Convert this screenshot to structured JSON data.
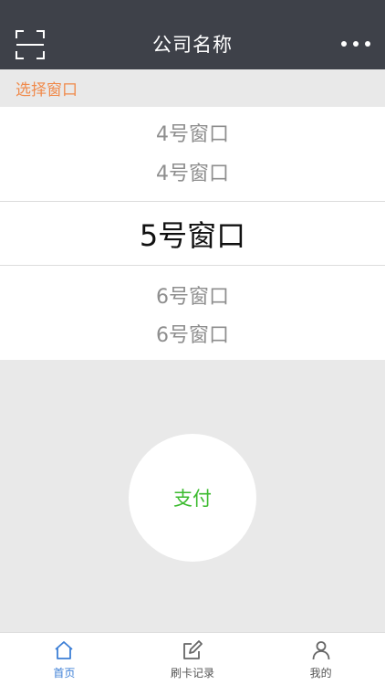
{
  "header": {
    "title": "公司名称",
    "left_icon": "scan-icon",
    "right_icon": "more-icon"
  },
  "section": {
    "label": "选择窗口"
  },
  "picker": {
    "items": [
      "4号窗口",
      "4号窗口",
      "5号窗口",
      "6号窗口",
      "6号窗口"
    ],
    "selected": "5号窗口"
  },
  "pay": {
    "label": "支付"
  },
  "tabs": [
    {
      "label": "首页",
      "icon": "home-icon",
      "active": true
    },
    {
      "label": "刷卡记录",
      "icon": "edit-icon",
      "active": false
    },
    {
      "label": "我的",
      "icon": "user-icon",
      "active": false
    }
  ],
  "colors": {
    "nav_bg": "#3e4149",
    "accent_orange": "#f08a4b",
    "pay_green": "#3cbb2f",
    "tab_active_blue": "#3d7fd6"
  }
}
